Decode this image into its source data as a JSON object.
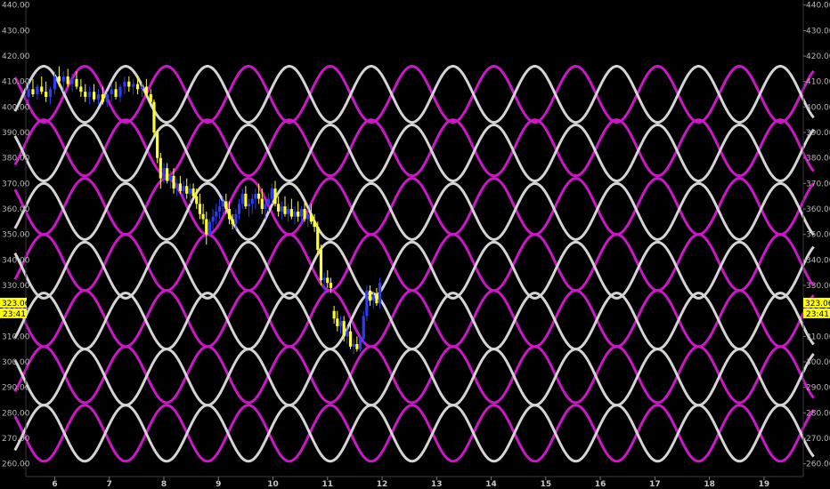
{
  "chart_data": {
    "type": "candlestick",
    "title": "",
    "xlabel": "",
    "ylabel": "",
    "ylim": [
      255,
      442
    ],
    "xlim": [
      5.47,
      19.72
    ],
    "y_ticks": [
      260,
      270,
      280,
      290,
      300,
      310,
      320,
      330,
      340,
      350,
      360,
      370,
      380,
      390,
      400,
      410,
      420,
      430,
      440
    ],
    "y_tick_labels": [
      "260.00",
      "270.00",
      "280.00",
      "290.00",
      "300.00",
      "310.00",
      "320.00",
      "330.00",
      "340.00",
      "350.00",
      "360.00",
      "370.00",
      "380.00",
      "390.00",
      "400.00",
      "410.00",
      "420.00",
      "430.00",
      "440.00"
    ],
    "x_ticks": [
      6,
      7,
      8,
      9,
      10,
      11,
      12,
      13,
      14,
      15,
      16,
      17,
      18,
      19
    ],
    "x_tick_labels": [
      "6",
      "7",
      "8",
      "9",
      "10",
      11,
      "12",
      "13",
      "14",
      "15",
      "16",
      "17",
      "18",
      "19"
    ],
    "grid": false,
    "legend": "none",
    "colors": {
      "background": "#000000",
      "up_candle": "#2a3cf5",
      "down_candle": "#ffff2e",
      "wave_magenta": "#cc16c8",
      "wave_white": "#d4d4d4",
      "axis_text": "#b4b4b4",
      "badge": "#ffff00"
    },
    "wave_series": {
      "period": 1.5,
      "amplitude": 11,
      "magenta": [
        {
          "center": 405,
          "phase_x": 6.55
        },
        {
          "center": 384,
          "phase_x": 5.8
        },
        {
          "center": 361,
          "phase_x": 6.55
        },
        {
          "center": 339,
          "phase_x": 5.8
        },
        {
          "center": 317,
          "phase_x": 6.55
        },
        {
          "center": 295,
          "phase_x": 5.8
        },
        {
          "center": 272,
          "phase_x": 6.55
        }
      ],
      "white": [
        {
          "center": 405,
          "phase_x": 5.8
        },
        {
          "center": 382,
          "phase_x": 6.55
        },
        {
          "center": 359,
          "phase_x": 5.8
        },
        {
          "center": 336,
          "phase_x": 6.55
        },
        {
          "center": 316,
          "phase_x": 5.8
        },
        {
          "center": 294,
          "phase_x": 6.55
        },
        {
          "center": 272,
          "phase_x": 5.8
        }
      ]
    },
    "candles": [
      [
        5.52,
        404,
        410,
        402,
        407
      ],
      [
        5.6,
        407,
        411,
        404,
        405
      ],
      [
        5.68,
        405,
        409,
        403,
        408
      ],
      [
        5.76,
        408,
        412,
        405,
        406
      ],
      [
        5.84,
        406,
        410,
        402,
        404
      ],
      [
        5.92,
        404,
        408,
        401,
        407
      ],
      [
        6.0,
        407,
        414,
        405,
        412
      ],
      [
        6.08,
        412,
        416,
        408,
        410
      ],
      [
        6.16,
        410,
        414,
        406,
        412
      ],
      [
        6.24,
        412,
        415,
        408,
        409
      ],
      [
        6.32,
        409,
        413,
        406,
        411
      ],
      [
        6.4,
        411,
        414,
        407,
        408
      ],
      [
        6.48,
        408,
        411,
        404,
        406
      ],
      [
        6.56,
        406,
        409,
        402,
        404
      ],
      [
        6.64,
        404,
        408,
        401,
        406
      ],
      [
        6.72,
        406,
        409,
        402,
        403
      ],
      [
        6.8,
        403,
        407,
        401,
        405
      ],
      [
        6.88,
        405,
        408,
        401,
        402
      ],
      [
        6.96,
        402,
        406,
        400,
        405
      ],
      [
        7.04,
        405,
        409,
        402,
        407
      ],
      [
        7.12,
        407,
        410,
        403,
        404
      ],
      [
        7.2,
        404,
        409,
        402,
        408
      ],
      [
        7.28,
        408,
        412,
        405,
        410
      ],
      [
        7.36,
        410,
        412,
        406,
        408
      ],
      [
        7.44,
        408,
        411,
        405,
        409
      ],
      [
        7.52,
        409,
        412,
        405,
        407
      ],
      [
        7.6,
        407,
        410,
        404,
        408
      ],
      [
        7.68,
        408,
        411,
        404,
        405
      ],
      [
        7.76,
        405,
        407,
        400,
        402
      ],
      [
        7.82,
        402,
        403,
        388,
        390
      ],
      [
        7.88,
        390,
        391,
        378,
        380
      ],
      [
        7.94,
        380,
        382,
        368,
        372
      ],
      [
        8.0,
        372,
        378,
        370,
        376
      ],
      [
        8.06,
        376,
        378,
        370,
        371
      ],
      [
        8.12,
        371,
        375,
        368,
        373
      ],
      [
        8.18,
        373,
        376,
        366,
        368
      ],
      [
        8.24,
        368,
        372,
        365,
        370
      ],
      [
        8.3,
        370,
        373,
        366,
        367
      ],
      [
        8.36,
        367,
        371,
        364,
        369
      ],
      [
        8.42,
        369,
        372,
        364,
        366
      ],
      [
        8.48,
        366,
        370,
        362,
        368
      ],
      [
        8.54,
        368,
        370,
        364,
        365
      ],
      [
        8.6,
        365,
        368,
        360,
        362
      ],
      [
        8.66,
        362,
        366,
        356,
        358
      ],
      [
        8.72,
        358,
        362,
        354,
        356
      ],
      [
        8.78,
        356,
        359,
        346,
        350
      ],
      [
        8.84,
        350,
        356,
        349,
        355
      ],
      [
        8.9,
        355,
        360,
        352,
        357
      ],
      [
        8.96,
        357,
        362,
        354,
        359
      ],
      [
        9.02,
        359,
        364,
        356,
        361
      ],
      [
        9.08,
        361,
        365,
        358,
        363
      ],
      [
        9.14,
        363,
        366,
        358,
        360
      ],
      [
        9.2,
        360,
        363,
        354,
        356
      ],
      [
        9.26,
        356,
        358,
        352,
        354
      ],
      [
        9.32,
        354,
        360,
        352,
        358
      ],
      [
        9.38,
        358,
        364,
        356,
        362
      ],
      [
        9.44,
        362,
        368,
        360,
        366
      ],
      [
        9.5,
        366,
        369,
        360,
        361
      ],
      [
        9.56,
        361,
        364,
        357,
        362
      ],
      [
        9.62,
        362,
        366,
        358,
        364
      ],
      [
        9.68,
        364,
        368,
        360,
        366
      ],
      [
        9.74,
        366,
        370,
        362,
        364
      ],
      [
        9.8,
        364,
        368,
        358,
        360
      ],
      [
        9.86,
        360,
        363,
        356,
        362
      ],
      [
        9.92,
        362,
        366,
        359,
        364
      ],
      [
        9.98,
        364,
        370,
        362,
        368
      ],
      [
        10.04,
        368,
        371,
        361,
        362
      ],
      [
        10.1,
        362,
        365,
        357,
        359
      ],
      [
        10.16,
        359,
        363,
        356,
        361
      ],
      [
        10.22,
        361,
        365,
        357,
        358
      ],
      [
        10.28,
        358,
        362,
        355,
        360
      ],
      [
        10.34,
        360,
        364,
        356,
        357
      ],
      [
        10.4,
        357,
        361,
        354,
        359
      ],
      [
        10.46,
        359,
        363,
        355,
        357
      ],
      [
        10.52,
        357,
        361,
        354,
        360
      ],
      [
        10.58,
        360,
        363,
        355,
        356
      ],
      [
        10.64,
        356,
        360,
        353,
        358
      ],
      [
        10.7,
        358,
        362,
        354,
        355
      ],
      [
        10.76,
        355,
        358,
        351,
        353
      ],
      [
        10.82,
        353,
        355,
        342,
        344
      ],
      [
        10.88,
        344,
        346,
        330,
        332
      ],
      [
        10.94,
        332,
        335,
        327,
        333
      ],
      [
        11.0,
        333,
        336,
        329,
        331
      ],
      [
        11.06,
        331,
        333,
        327,
        329
      ],
      [
        11.12,
        320,
        322,
        315,
        317
      ],
      [
        11.18,
        317,
        320,
        312,
        314
      ],
      [
        11.24,
        314,
        318,
        311,
        316
      ],
      [
        11.3,
        316,
        318,
        308,
        310
      ],
      [
        11.36,
        310,
        314,
        307,
        312
      ],
      [
        11.42,
        312,
        315,
        305,
        306
      ],
      [
        11.48,
        306,
        309,
        303,
        307
      ],
      [
        11.54,
        307,
        310,
        304,
        305
      ],
      [
        11.6,
        305,
        310,
        304,
        309
      ],
      [
        11.66,
        309,
        320,
        307,
        318
      ],
      [
        11.72,
        318,
        330,
        316,
        328
      ],
      [
        11.78,
        328,
        330,
        322,
        324
      ],
      [
        11.84,
        324,
        328,
        321,
        326
      ],
      [
        11.9,
        326,
        329,
        322,
        323
      ],
      [
        11.96,
        323,
        333,
        321,
        331
      ]
    ],
    "last_price": {
      "value": 323.06,
      "label": "323.06",
      "time_label": "23:41"
    }
  }
}
